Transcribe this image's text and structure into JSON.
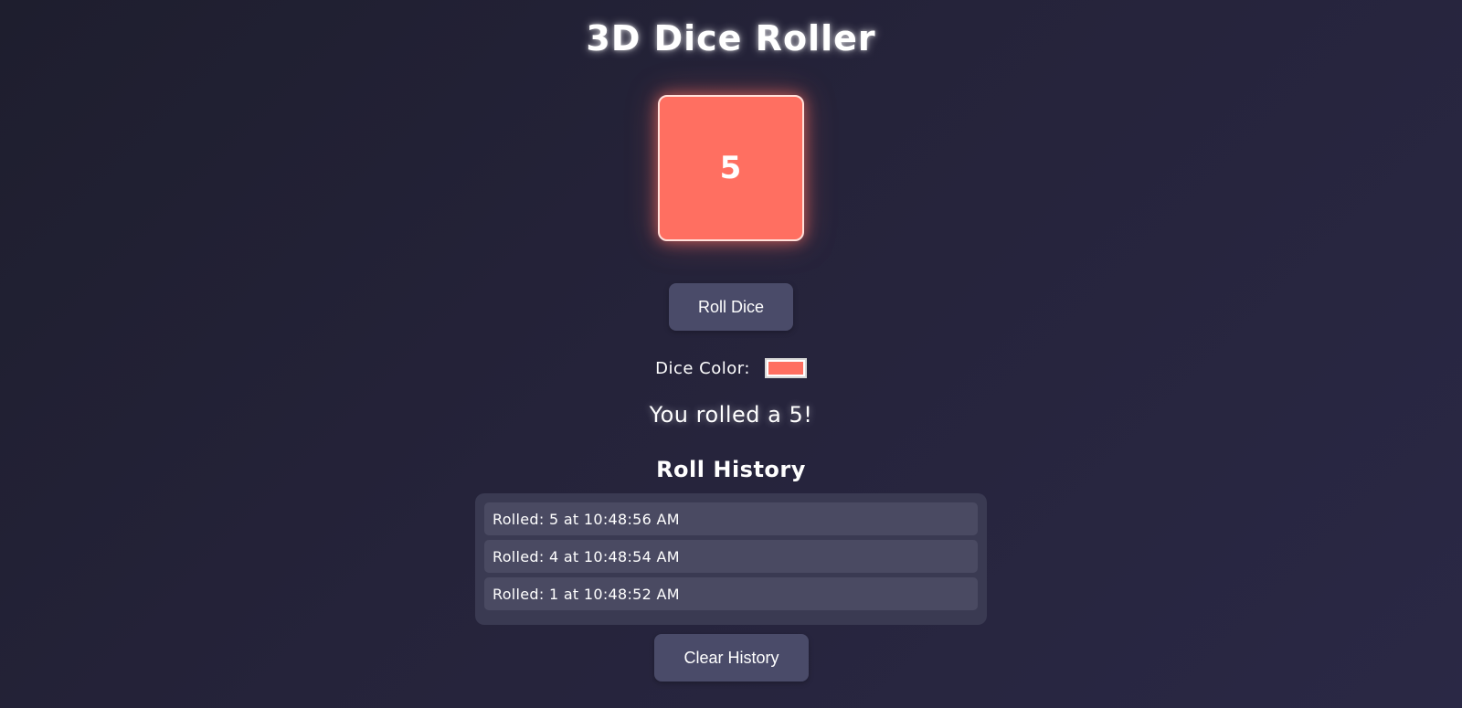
{
  "app": {
    "title": "3D Dice Roller"
  },
  "dice": {
    "value": "5",
    "color": "#ff6f61"
  },
  "controls": {
    "roll_label": "Roll Dice",
    "color_label": "Dice Color:",
    "color_value": "#ff6f61"
  },
  "result": {
    "text": "You rolled a 5!"
  },
  "history": {
    "title": "Roll History",
    "items": [
      {
        "text": "Rolled: 5 at 10:48:56 AM"
      },
      {
        "text": "Rolled: 4 at 10:48:54 AM"
      },
      {
        "text": "Rolled: 1 at 10:48:52 AM"
      }
    ],
    "clear_label": "Clear History"
  },
  "colors": {
    "background": "#22223a",
    "button": "#4a4b69",
    "panel": "#3a3a52",
    "item": "#4a4a62"
  }
}
